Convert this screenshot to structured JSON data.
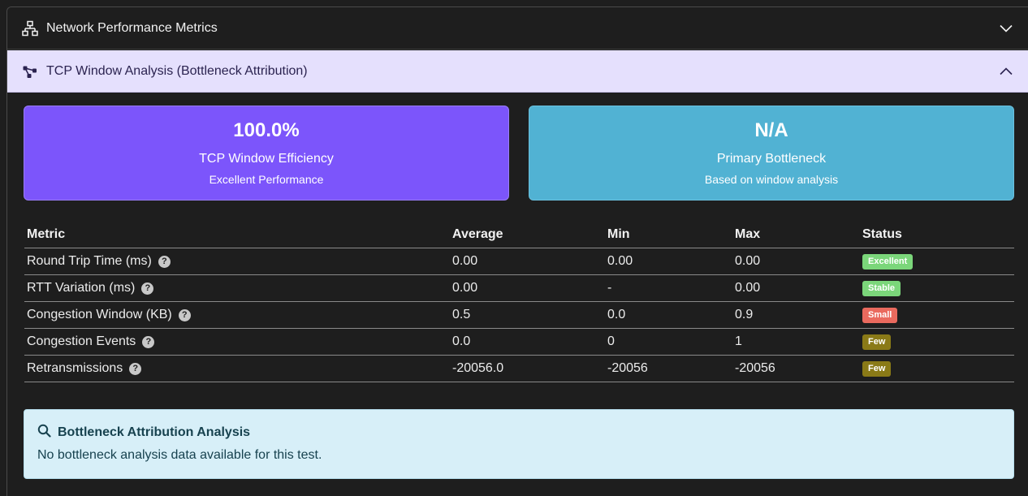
{
  "sections": {
    "network": {
      "title": "Network Performance Metrics",
      "icon": "network-icon",
      "state": "collapsed"
    },
    "tcp": {
      "title": "TCP Window Analysis (Bottleneck Attribution)",
      "icon": "share-nodes-icon",
      "state": "expanded"
    }
  },
  "cards": [
    {
      "value": "100.0%",
      "label": "TCP Window Efficiency",
      "sub": "Excellent Performance",
      "color": "#7c55fb"
    },
    {
      "value": "N/A",
      "label": "Primary Bottleneck",
      "sub": "Based on window analysis",
      "color": "#51b2d3"
    }
  ],
  "table": {
    "headers": [
      "Metric",
      "Average",
      "Min",
      "Max",
      "Status"
    ],
    "rows": [
      {
        "metric": "Round Trip Time (ms)",
        "avg": "0.00",
        "min": "0.00",
        "max": "0.00",
        "status": "Excellent",
        "status_color": "#7bd67a",
        "status_text_color": "#ffffff"
      },
      {
        "metric": "RTT Variation (ms)",
        "avg": "0.00",
        "min": "-",
        "max": "0.00",
        "status": "Stable",
        "status_color": "#7bd67a",
        "status_text_color": "#ffffff"
      },
      {
        "metric": "Congestion Window (KB)",
        "avg": "0.5",
        "min": "0.0",
        "max": "0.9",
        "status": "Small",
        "status_color": "#ea6a5e",
        "status_text_color": "#ffffff"
      },
      {
        "metric": "Congestion Events",
        "avg": "0.0",
        "min": "0",
        "max": "1",
        "status": "Few",
        "status_color": "#8a7a17",
        "status_text_color": "#ffffff"
      },
      {
        "metric": "Retransmissions",
        "avg": "-20056.0",
        "min": "-20056",
        "max": "-20056",
        "status": "Few",
        "status_color": "#8a7a17",
        "status_text_color": "#ffffff"
      }
    ],
    "help_glyph": "?"
  },
  "alert": {
    "icon": "search-icon",
    "title": "Bottleneck Attribution Analysis",
    "text": "No bottleneck analysis data available for this test."
  }
}
